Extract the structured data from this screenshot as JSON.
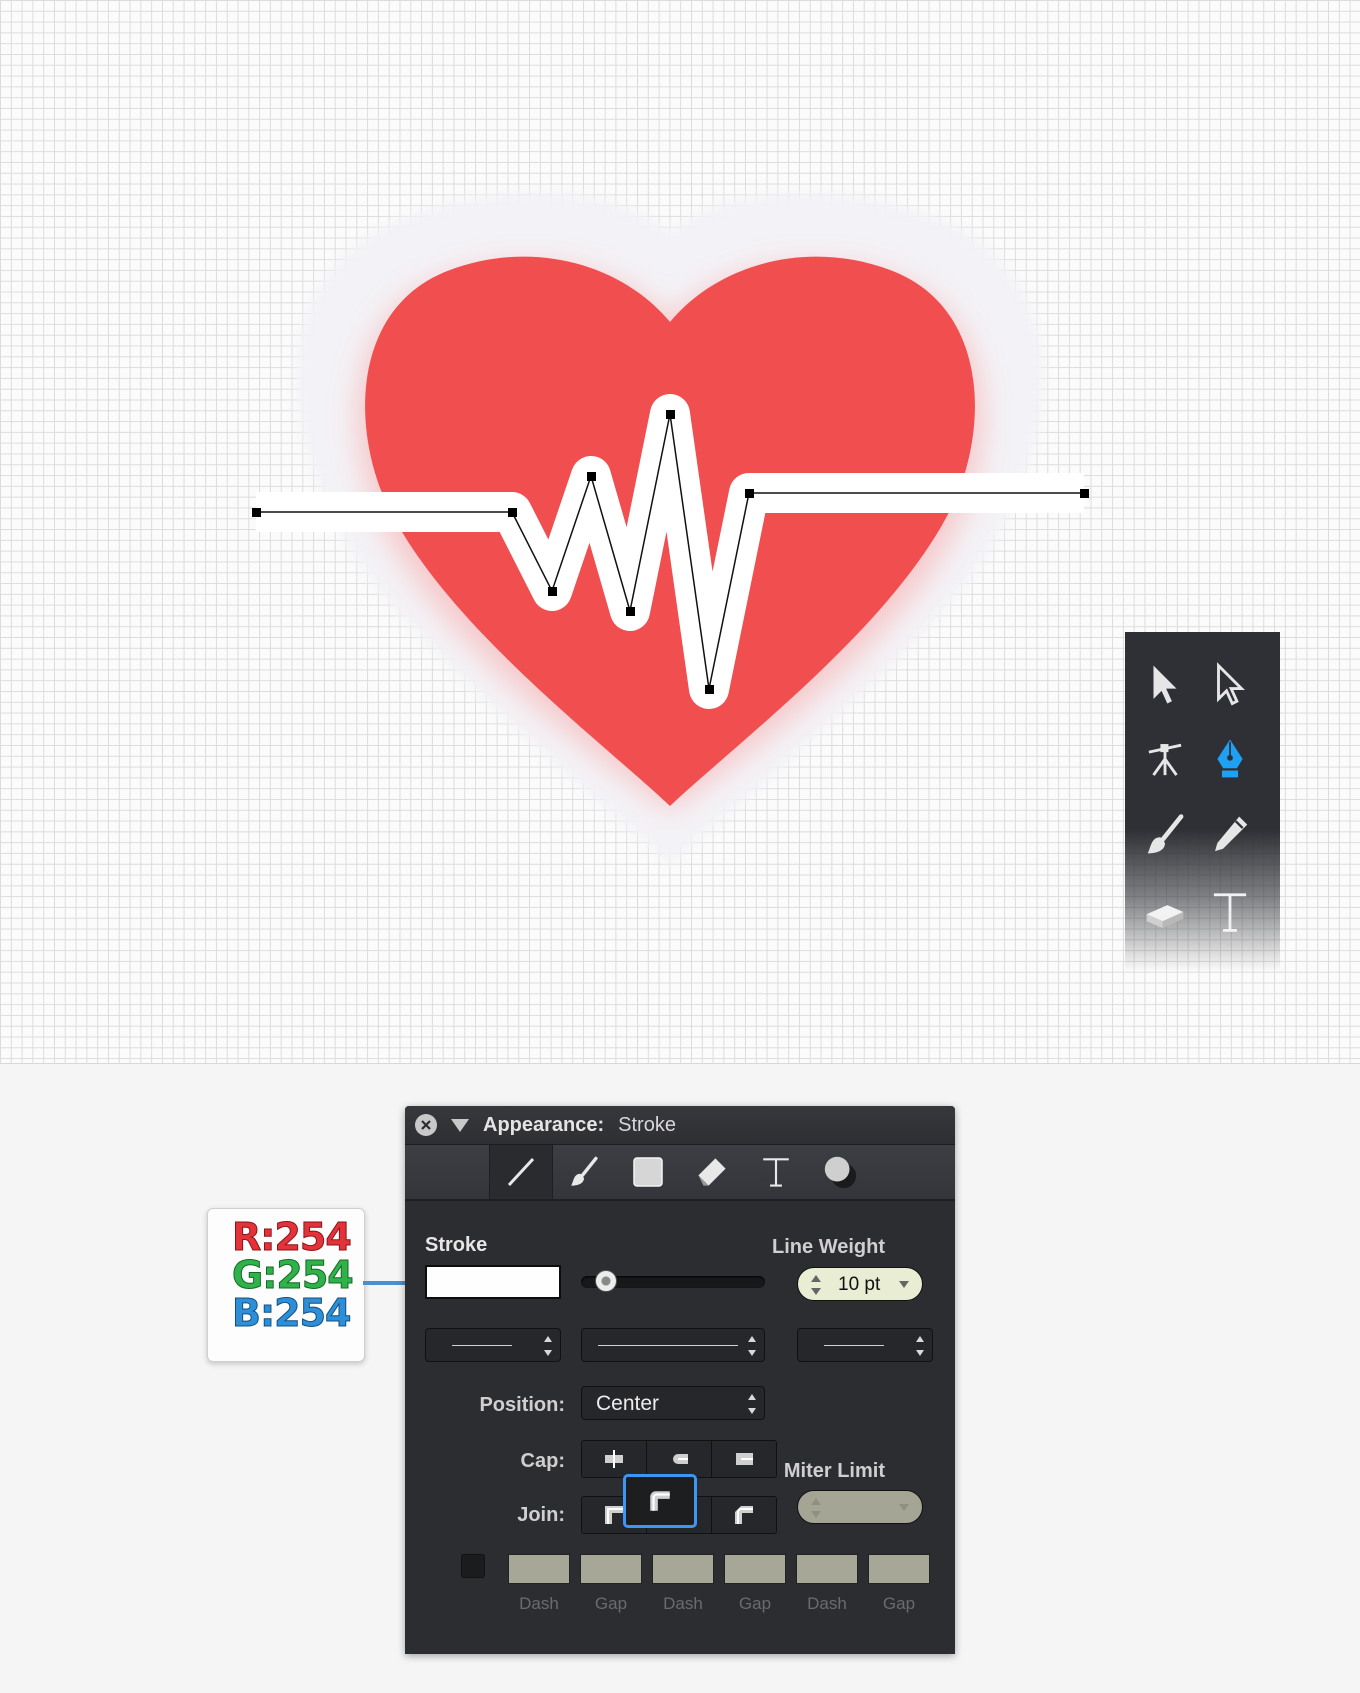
{
  "toolbox": {
    "tools": [
      {
        "name": "selection-tool",
        "icon": "arrow-filled-icon"
      },
      {
        "name": "direct-selection-tool",
        "icon": "arrow-outline-icon"
      },
      {
        "name": "anchor-point-tool",
        "icon": "anchor-point-icon"
      },
      {
        "name": "pen-tool",
        "icon": "pen-nib-icon",
        "active": true
      },
      {
        "name": "brush-tool",
        "icon": "brush-icon"
      },
      {
        "name": "pencil-tool",
        "icon": "pencil-icon"
      },
      {
        "name": "eraser-tool",
        "icon": "eraser-icon"
      },
      {
        "name": "text-tool",
        "icon": "text-t-icon"
      }
    ],
    "active_color": "#1ea1f2"
  },
  "artwork": {
    "heart_color": "#f04e4f",
    "heart_halo_color": "#f4f3f6",
    "pulse_stroke_color": "#ffffff"
  },
  "panel": {
    "title_label": "Appearance:",
    "title_value": "Stroke",
    "tabs": [
      "stroke",
      "brush",
      "fill",
      "shape",
      "text",
      "effects"
    ],
    "stroke_label": "Stroke",
    "line_weight_label": "Line Weight",
    "line_weight_value": "10 pt",
    "position_label": "Position:",
    "position_value": "Center",
    "cap_label": "Cap:",
    "join_label": "Join:",
    "miter_limit_label": "Miter Limit",
    "dash_labels": [
      "Dash",
      "Gap",
      "Dash",
      "Gap",
      "Dash",
      "Gap"
    ],
    "selected_join": "round",
    "stroke_color": "#fefefe"
  },
  "rgb_callout": {
    "r": "R:254",
    "g": "G:254",
    "b": "B:254"
  }
}
